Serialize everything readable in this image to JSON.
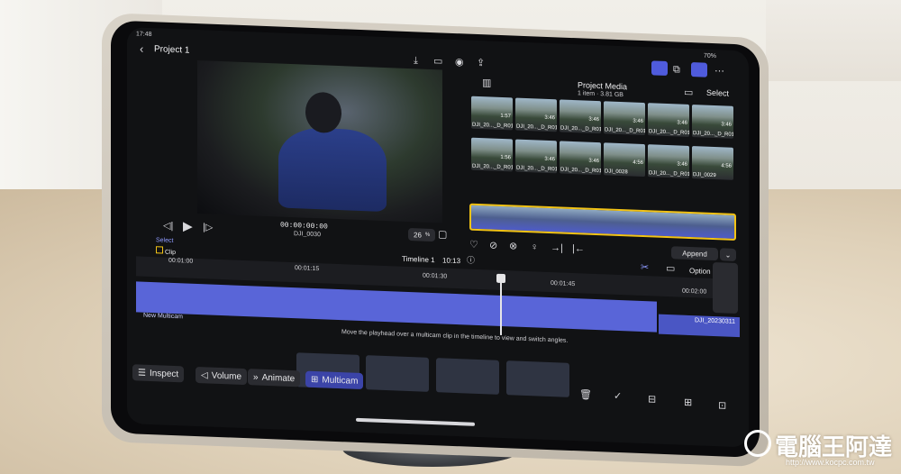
{
  "status": {
    "time": "17:48",
    "battery": "70%"
  },
  "header": {
    "project_title": "Project 1"
  },
  "viewer": {
    "timecode": "00:00:00:00",
    "clip_name": "DJI_0030",
    "zoom": "26",
    "zoom_unit": "%"
  },
  "browser": {
    "title": "Project Media",
    "subtitle": "1 item · 3.81 GB",
    "select_label": "Select",
    "append_label": "Append",
    "thumbnails": [
      {
        "name": "DJI_20..._D_R01",
        "duration": "1:57"
      },
      {
        "name": "DJI_20..._D_R01",
        "duration": "3:46"
      },
      {
        "name": "DJI_20..._D_R01",
        "duration": "3:46"
      },
      {
        "name": "DJI_20..._D_R01",
        "duration": "3:46"
      },
      {
        "name": "DJI_20..._D_R01",
        "duration": "3:46"
      },
      {
        "name": "DJI_20..._D_R01",
        "duration": "3:46"
      },
      {
        "name": "DJI_20..._D_R01",
        "duration": "1:56"
      },
      {
        "name": "DJI_20..._D_R01",
        "duration": "3:46"
      },
      {
        "name": "DJI_20..._D_R01",
        "duration": "3:46"
      },
      {
        "name": "DJI_0028",
        "duration": "4:56"
      },
      {
        "name": "DJI_20..._D_R01",
        "duration": "3:46"
      },
      {
        "name": "DJI_0029",
        "duration": "4:56"
      }
    ]
  },
  "timeline": {
    "select_label": "Select",
    "clip_label": "Clip",
    "title": "Timeline 1",
    "duration": "10:13",
    "options_label": "Option",
    "ticks": [
      "00:01:00",
      "00:01:15",
      "00:01:30",
      "00:01:45",
      "00:02:00"
    ],
    "multicam_label": "New Multicam",
    "hint": "Move the playhead over a multicam clip in the timeline to view and switch angles.",
    "next_clip": "DJI_20230311"
  },
  "toolbar": {
    "inspect": "Inspect",
    "volume": "Volume",
    "animate": "Animate",
    "multicam": "Multicam"
  },
  "watermark": {
    "brand": "電腦王阿達",
    "url": "http://www.kocpc.com.tw"
  },
  "colors": {
    "accent": "#5b67e6",
    "clip_blue": "#5965d8",
    "yellow_trim": "#f2c316"
  }
}
